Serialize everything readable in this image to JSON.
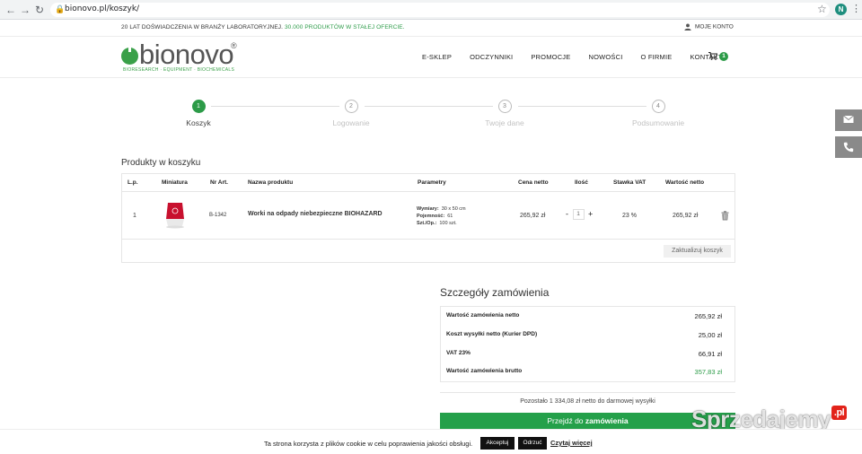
{
  "browser": {
    "url": "bionovo.pl/koszyk/",
    "profile_initial": "N"
  },
  "topbar": {
    "promo_text": "20 LAT DOŚWIADCZENIA W BRANŻY LABORATORYJNEJ.",
    "promo_highlight": " 30.000 PRODUKTÓW W STAŁEJ OFERCIE.",
    "account_label": "MOJE KONTO"
  },
  "logo": {
    "word": "bionovo",
    "tagline": "BIORESEARCH · EQUIPMENT · BIOCHEMICALS",
    "registered": "®"
  },
  "nav": {
    "items": [
      "E-SKLEP",
      "ODCZYNNIKI",
      "PROMOCJE",
      "NOWOŚCI",
      "O FIRMIE",
      "KONTAKT"
    ],
    "cart_count": "1"
  },
  "steps": [
    {
      "number": "1",
      "label": "Koszyk",
      "active": true
    },
    {
      "number": "2",
      "label": "Logowanie",
      "active": false
    },
    {
      "number": "3",
      "label": "Twoje dane",
      "active": false
    },
    {
      "number": "4",
      "label": "Podsumowanie",
      "active": false
    }
  ],
  "cart": {
    "title": "Produkty w koszyku",
    "headers": {
      "lp": "L.p.",
      "thumb": "Miniatura",
      "sku": "Nr Art.",
      "name": "Nazwa produktu",
      "params": "Parametry",
      "price": "Cena netto",
      "qty": "Ilość",
      "vat": "Stawka VAT",
      "total": "Wartość netto"
    },
    "items": [
      {
        "lp": "1",
        "sku": "B-1342",
        "name": "Worki na odpady niebezpieczne BIOHAZARD",
        "params": [
          {
            "label": "Wymiary:",
            "value": "30 x 50 cm"
          },
          {
            "label": "Pojemność:",
            "value": "61"
          },
          {
            "label": "Szt./Op.:",
            "value": "100 szt."
          }
        ],
        "price": "265,92 zł",
        "qty": "1",
        "vat": "23 %",
        "total": "265,92 zł"
      }
    ],
    "update_label": "Zaktualizuj koszyk"
  },
  "details": {
    "title": "Szczegóły zamówienia",
    "rows": [
      {
        "label": "Wartość zamówienia netto",
        "value": "265,92 zł"
      },
      {
        "label": "Koszt wysyłki netto (Kurier DPD)",
        "value": "25,00 zł"
      },
      {
        "label": "VAT 23%",
        "value": "66,91 zł"
      },
      {
        "label": "Wartość zamówienia brutto",
        "value": "357,83 zł"
      }
    ],
    "free_shipping": "Pozostało 1 334,08 zł netto do darmowej wysyłki",
    "checkout_prefix": "Przejdź do ",
    "checkout_bold": "zamówienia"
  },
  "cookie": {
    "text": "Ta strona korzysta z plików cookie w celu poprawienia jakości obsługi.",
    "accept": "Akceptuj",
    "reject": "Odrzuć",
    "more": "Czytaj więcej"
  },
  "watermark": {
    "text": "Sprzedajemy",
    "suffix": ".pl"
  },
  "colors": {
    "brand_green": "#2c9b48",
    "checkout_green": "#24a04a",
    "side_button": "#8a8a8a"
  }
}
